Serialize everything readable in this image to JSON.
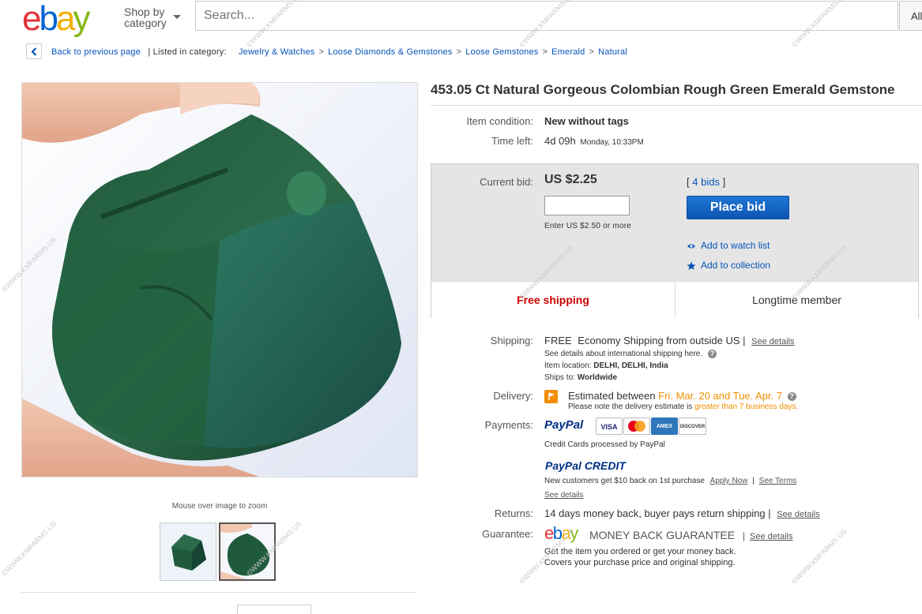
{
  "header": {
    "logo_letters": [
      "e",
      "b",
      "a",
      "y"
    ],
    "logo_colors": [
      "#e53238",
      "#0064d2",
      "#f5af02",
      "#86b817"
    ],
    "shop_by_category": [
      "Shop by",
      "category"
    ],
    "search_placeholder": "Search...",
    "all_categories": "All"
  },
  "breadcrumb": {
    "back_label": "Back to previous page",
    "listed_in": "| Listed in category:",
    "items": [
      "Jewelry & Watches",
      "Loose Diamonds & Gemstones",
      "Loose Gemstones",
      "Emerald",
      "Natural"
    ],
    "separator": ">"
  },
  "gallery": {
    "zoom_hint": "Mouse over image to zoom",
    "thumbnail_count": 2,
    "selected_thumbnail": 2
  },
  "listing": {
    "title": "453.05 Ct Natural Gorgeous Colombian Rough Green Emerald Gemstone",
    "condition_label": "Item condition:",
    "condition_value": "New without tags",
    "time_left_label": "Time left:",
    "time_left_value": "4d 09h",
    "time_left_end": "Monday, 10:33PM",
    "current_bid_label": "Current bid:",
    "current_bid_value": "US $2.25",
    "bids_open": "[",
    "bids_link": "4 bids",
    "bids_close": "]",
    "bid_hint": "Enter US $2.50 or more",
    "place_bid": "Place bid",
    "watch_list": "Add to watch list",
    "collection": "Add to collection",
    "free_shipping": "Free shipping",
    "longtime_member": "Longtime member"
  },
  "shipping": {
    "label": "Shipping:",
    "free": "FREE",
    "method": "Economy Shipping from outside US |",
    "see_details": "See details",
    "intl_note": "See details about international shipping here.",
    "location_label": "Item location:",
    "location_value": "DELHI, DELHI, India",
    "ships_to_label": "Ships to:",
    "ships_to_value": "Worldwide"
  },
  "delivery": {
    "label": "Delivery:",
    "estimated_prefix": "Estimated between",
    "estimated_dates": "Fri. Mar. 20 and Tue. Apr. 7",
    "note_prefix": "Please note the delivery estimate is",
    "note_emphasis": "greater than 7 business days."
  },
  "payments": {
    "label": "Payments:",
    "paypal": "PayPal",
    "cards": [
      "VISA",
      "MC",
      "AMEX",
      "DISCOVER"
    ],
    "card_note": "Credit Cards processed by PayPal",
    "paypal_credit": "PayPal CREDIT",
    "credit_note": "New customers get $10 back on 1st purchase",
    "apply_now": "Apply Now",
    "see_terms": "See Terms",
    "see_details": "See details"
  },
  "returns": {
    "label": "Returns:",
    "value": "14 days money back, buyer pays return shipping |",
    "see_details": "See details"
  },
  "guarantee": {
    "label": "Guarantee:",
    "title": "MONEY BACK GUARANTEE",
    "see_details": "See details",
    "line1": "Get the item you ordered or get your money back.",
    "line2": "Covers your purchase price and original shipping."
  },
  "watermark": "©WWW.KMFARMS.US",
  "colors": {
    "link": "#0654ba",
    "red": "#c00",
    "orange": "#f18e00",
    "place_bid_blue": "#0d55b3"
  }
}
